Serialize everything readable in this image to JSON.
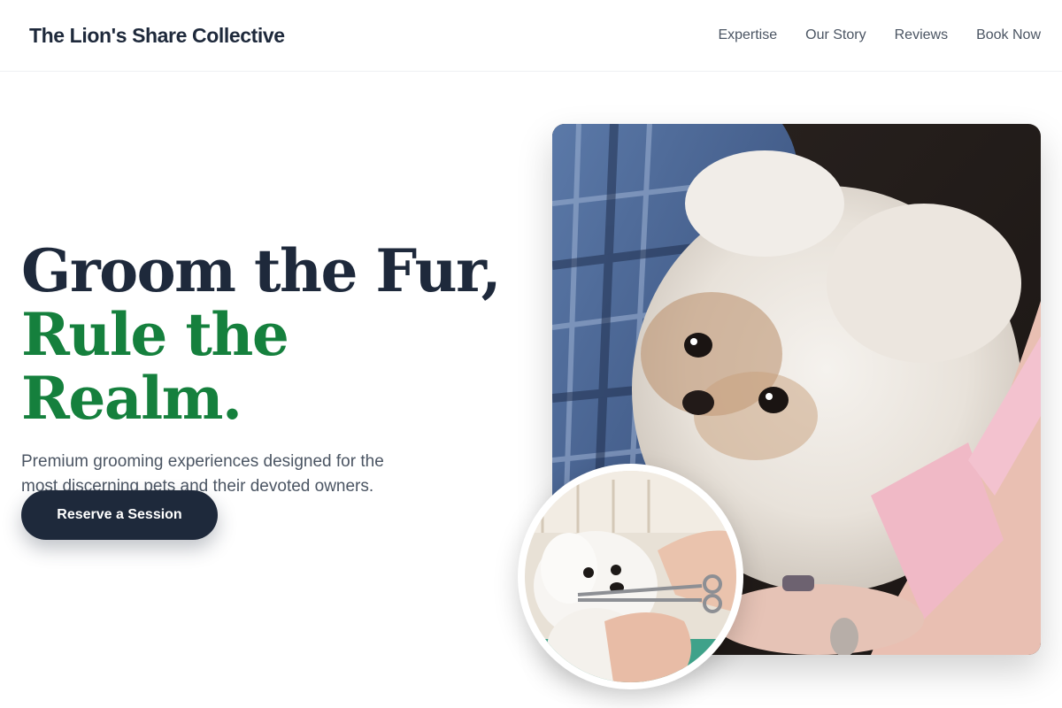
{
  "header": {
    "brand": "The Lion's Share Collective",
    "nav": [
      {
        "label": "Expertise"
      },
      {
        "label": "Our Story"
      },
      {
        "label": "Reviews"
      },
      {
        "label": "Book Now"
      }
    ]
  },
  "hero": {
    "headline_line1": "Groom the Fur,",
    "headline_line2": "Rule the Realm.",
    "subtitle": "Premium grooming experiences designed for the most discerning pets and their devoted owners.",
    "cta_label": "Reserve a Session"
  },
  "colors": {
    "primary_dark": "#1e293b",
    "accent_green": "#15803d",
    "body_text": "#4b5563"
  }
}
